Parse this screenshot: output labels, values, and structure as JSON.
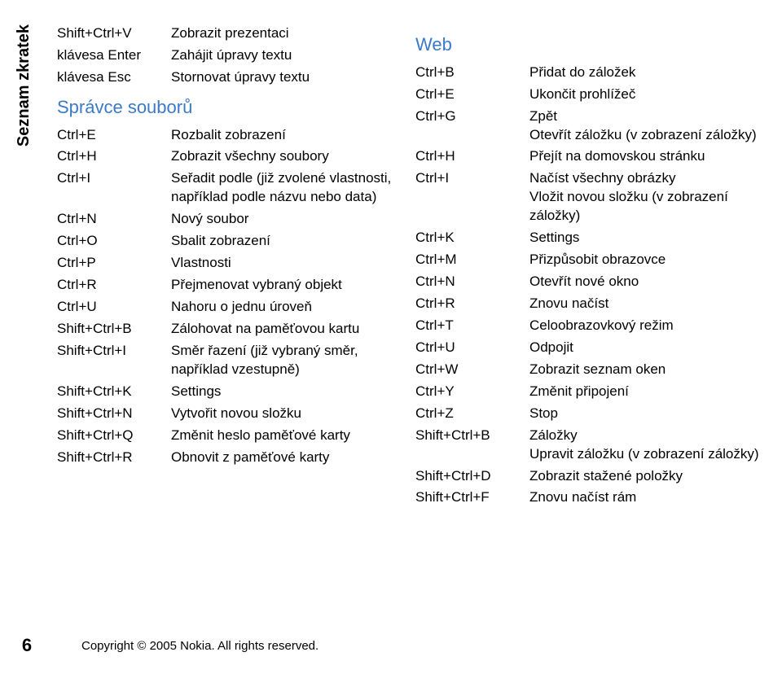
{
  "sideLabel": "Seznam zkratek",
  "pageNumber": "6",
  "footer": "Copyright © 2005 Nokia. All rights reserved.",
  "col1": {
    "initial": [
      {
        "k": "Shift+Ctrl+V",
        "d": "Zobrazit prezentaci"
      },
      {
        "k": "klávesa Enter",
        "d": "Zahájit úpravy textu"
      },
      {
        "k": "klávesa Esc",
        "d": "Stornovat úpravy textu"
      }
    ],
    "sectionTitle": "Správce souborů",
    "rows": [
      {
        "k": "Ctrl+E",
        "d": "Rozbalit zobrazení"
      },
      {
        "k": "Ctrl+H",
        "d": "Zobrazit všechny soubory"
      },
      {
        "k": "Ctrl+I",
        "d": "Seřadit podle (již zvolené vlastnosti, například podle názvu nebo data)"
      },
      {
        "k": "Ctrl+N",
        "d": "Nový soubor"
      },
      {
        "k": "Ctrl+O",
        "d": "Sbalit zobrazení"
      },
      {
        "k": "Ctrl+P",
        "d": "Vlastnosti"
      },
      {
        "k": "Ctrl+R",
        "d": "Přejmenovat vybraný objekt"
      },
      {
        "k": "Ctrl+U",
        "d": "Nahoru o jednu úroveň"
      },
      {
        "k": "Shift+Ctrl+B",
        "d": "Zálohovat na paměťovou kartu"
      },
      {
        "k": "Shift+Ctrl+I",
        "d": "Směr řazení (již vybraný směr, například vzestupně)"
      },
      {
        "k": "Shift+Ctrl+K",
        "d": "Settings"
      },
      {
        "k": "Shift+Ctrl+N",
        "d": "Vytvořit novou složku"
      },
      {
        "k": "Shift+Ctrl+Q",
        "d": "Změnit heslo paměťové karty"
      },
      {
        "k": "Shift+Ctrl+R",
        "d": "Obnovit z paměťové karty"
      }
    ]
  },
  "col2": {
    "sectionTitle": "Web",
    "rows": [
      {
        "k": "Ctrl+B",
        "d": "Přidat do záložek"
      },
      {
        "k": "Ctrl+E",
        "d": "Ukončit prohlížeč"
      },
      {
        "k": "Ctrl+G",
        "d": "Zpět\nOtevřít záložku (v zobrazení záložky)"
      },
      {
        "k": "Ctrl+H",
        "d": "Přejít na domovskou stránku"
      },
      {
        "k": "Ctrl+I",
        "d": "Načíst všechny obrázky\nVložit novou složku (v zobrazení záložky)"
      },
      {
        "k": "Ctrl+K",
        "d": "Settings"
      },
      {
        "k": "Ctrl+M",
        "d": "Přizpůsobit obrazovce"
      },
      {
        "k": "Ctrl+N",
        "d": "Otevřít nové okno"
      },
      {
        "k": "Ctrl+R",
        "d": "Znovu načíst"
      },
      {
        "k": "Ctrl+T",
        "d": "Celoobrazovkový režim"
      },
      {
        "k": "Ctrl+U",
        "d": "Odpojit"
      },
      {
        "k": "Ctrl+W",
        "d": "Zobrazit seznam oken"
      },
      {
        "k": "Ctrl+Y",
        "d": "Změnit připojení"
      },
      {
        "k": "Ctrl+Z",
        "d": "Stop"
      },
      {
        "k": "Shift+Ctrl+B",
        "d": "Záložky\nUpravit záložku (v zobrazení záložky)"
      },
      {
        "k": "Shift+Ctrl+D",
        "d": "Zobrazit stažené položky"
      },
      {
        "k": "Shift+Ctrl+F",
        "d": "Znovu načíst rám"
      }
    ]
  }
}
